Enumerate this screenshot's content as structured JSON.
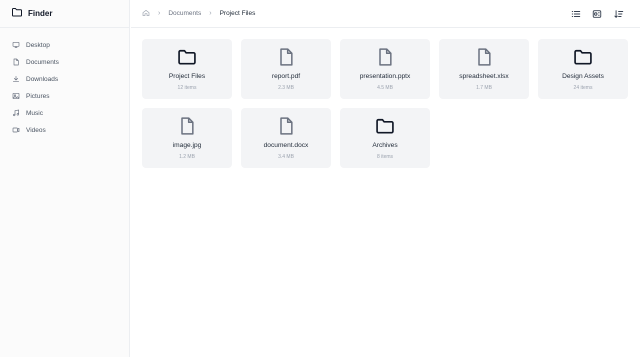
{
  "app": {
    "title": "Finder"
  },
  "sidebar": {
    "items": [
      {
        "label": "Desktop",
        "icon": "monitor-icon"
      },
      {
        "label": "Documents",
        "icon": "document-icon"
      },
      {
        "label": "Downloads",
        "icon": "download-icon"
      },
      {
        "label": "Pictures",
        "icon": "image-icon"
      },
      {
        "label": "Music",
        "icon": "music-icon"
      },
      {
        "label": "Videos",
        "icon": "video-icon"
      }
    ]
  },
  "breadcrumb": {
    "home_icon": "home-icon",
    "items": [
      "Documents",
      "Project Files"
    ]
  },
  "toolbar": {
    "icons": [
      "list-view-icon",
      "toggle-view-icon",
      "sort-icon"
    ]
  },
  "files": [
    {
      "name": "Project Files",
      "meta": "12 items",
      "type": "folder"
    },
    {
      "name": "report.pdf",
      "meta": "2.3 MB",
      "type": "file"
    },
    {
      "name": "presentation.pptx",
      "meta": "4.5 MB",
      "type": "file"
    },
    {
      "name": "spreadsheet.xlsx",
      "meta": "1.7 MB",
      "type": "file"
    },
    {
      "name": "Design Assets",
      "meta": "24 items",
      "type": "folder"
    },
    {
      "name": "image.jpg",
      "meta": "1.2 MB",
      "type": "file"
    },
    {
      "name": "document.docx",
      "meta": "3.4 MB",
      "type": "file"
    },
    {
      "name": "Archives",
      "meta": "8 items",
      "type": "folder"
    }
  ]
}
